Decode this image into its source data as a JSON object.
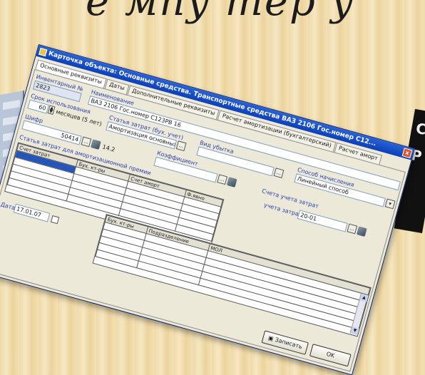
{
  "slide": {
    "title_fragment": "е мпу тер у"
  },
  "window": {
    "title": "Карточка объекта: Основные средства. Транспортные средства ВАЗ 2106 Гос.номер С12...",
    "close_label": "x"
  },
  "tabs": [
    "Основные реквизиты",
    "Даты",
    "Дополнительные реквизиты",
    "Расчет амортизации (бухгалтерский)",
    "Расчет аморт"
  ],
  "fields": {
    "inventory_label": "Инвентарный №",
    "inventory_value": "2823",
    "name_label": "Наименование",
    "name_value": "ВАЗ 2106 Гос.номер С123РВ 16",
    "useful_life_label": "Срок использования",
    "useful_life_value": "60",
    "useful_life_unit": "месяцев (5 лет)",
    "cost_group_label": "Статья затрат (бух. учет)",
    "cost_group_value": "Амортизация основных",
    "writeoff_label": "Вид убытка",
    "writeoff_value": "",
    "method_label": "Способ начисления",
    "method_value": "Линейный способ",
    "amount_label": "Шифр",
    "amount_value": "50414",
    "amount_aux": "14.2",
    "cost_tax_label": "Статья затрат для амортизационной премии",
    "coefficient_label": "Коэффициент",
    "accounts_label": "Счета учета затрат",
    "account_label": "учета затрат",
    "account_value": "20-01",
    "date_label": "Дата",
    "date_value": "17.01.07"
  },
  "grid1": {
    "headers": [
      "Счет затрат",
      "Бух. кт-ры",
      "Счет аморт",
      "Ф.явно",
      "Бух. кт-ры",
      "Подразделение",
      "МОЛ"
    ],
    "rows": 6
  },
  "buttons": {
    "save": "Записать",
    "ok": "OK"
  }
}
